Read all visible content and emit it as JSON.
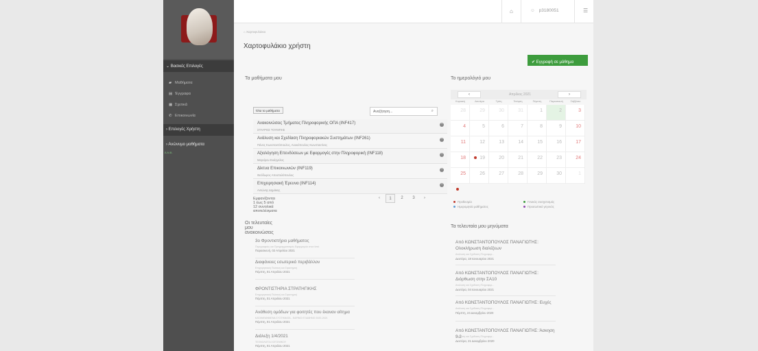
{
  "colors": {
    "accent": "#3d9c3d",
    "sidebar": "#4f4f4f",
    "event_red": "#c0392b"
  },
  "topbar": {
    "home_icon": "home-icon",
    "user_icon": "user-icon",
    "menu_icon": "menu-icon",
    "username": "p3180051"
  },
  "sidebar": {
    "section_main": "Βασικές Επιλογές",
    "items": [
      {
        "label": "Μαθήματα",
        "icon": "mortarboard-icon"
      },
      {
        "label": "Έγγραφα",
        "icon": "document-icon"
      },
      {
        "label": "Σχετικά",
        "icon": "calendar-icon"
      },
      {
        "label": "Επικοινωνία",
        "icon": "phone-icon"
      }
    ],
    "section_user": "Επιλογές Χρήστη",
    "section_anon": "Ανώνυμο μαθήματα",
    "small_text": "Ά.Ν.Β."
  },
  "breadcrumb": "Χαρτοφυλάκιο",
  "page_title": "Χαρτοφυλάκιο χρήστη",
  "enroll_button": "Εγγραφή σε μάθημα",
  "courses": {
    "title": "Τα μαθήματα μου",
    "all_button": "Όλα τα μαθήματα",
    "search_placeholder": "Αναζήτηση...",
    "items": [
      {
        "name": "Ανακοινώσεις Τμήματος Πληροφορικής ΟΠΑ (INF417)",
        "prof": "ΣΤΑΥΡΟΣ ΤΟΥΜΠΗΣ"
      },
      {
        "name": "Ανάλυση και Σχεδίαση Πληροφοριακών Συστημάτων (INF261)",
        "prof": "Πάνος Κωνσταντόπουλος, Λουκόπουλος Κωνσταντίνος"
      },
      {
        "name": "Αξιολόγηση Επενδύσεων με Εφαρμογές στην Πληροφορική (INF118)",
        "prof": "Μαγείρου Ευάγγελος"
      },
      {
        "name": "Δίκτυα Επικοινωνιών (INF119)",
        "prof": "Θεόδωρος Αποστολόπουλος"
      },
      {
        "name": "Επιχειρησιακή Έρευνα (INF114)",
        "prof": "Αντώνης Δημάκης"
      }
    ],
    "pagination_info": "Εμφανίζονται 1 έως 5 από 12 συνολικά αποτελέσματα",
    "pages": [
      "‹",
      "1",
      "2",
      "3",
      "›"
    ]
  },
  "announcements": {
    "title": "Οι τελευταίες μου ανακοινώσεις",
    "items": [
      {
        "title": "3ο Φροντιστήριο μαθήματος",
        "sub": "Περιγραφικές και Προγραμματισμός Εφαρμογών στον Ιστό",
        "date": "Παρασκευή, 02 Απριλίου 2021"
      },
      {
        "title": "Διαφάνειες εσωτερικό περιβάλλον",
        "sub": "Επιχειρησιακή Πολιτική και Στρατηγική",
        "date": "Πέμπτη, 01 Απριλίου 2021"
      },
      {
        "title": "ΦΡΟΝΤΙΣΤΗΡΙΑ ΣΤΡΑΤΗΓΙΚΗΣ",
        "sub": "Επιχειρησιακή Πολιτική και Στρατηγική",
        "date": "Πέμπτη, 01 Απριλίου 2021"
      },
      {
        "title": "Ανάθεση ομάδων για φοιτητές που έκαναν αίτημα",
        "sub": "ΚΑΤΑΝΕΜΗΜΕΝΑ ΣΥΣΤΗΜΑΤΑ - ΕΑΡΙΝΟ ΕΞΑΜΗΝΟ 2020-2021",
        "date": "Πέμπτη, 01 Απριλίου 2021"
      },
      {
        "title": "Διάλεξη 1/4/2021",
        "sub": "ΤΕΧΝΟΛΟΓΙΑ ΛΟΓΙΣΜΙΚΟΥ",
        "date": "Πέμπτη, 01 Απριλίου 2021"
      }
    ]
  },
  "calendar": {
    "title": "Το ημερολόγιό μου",
    "month": "Απρίλιος 2021",
    "prev": "‹",
    "next": "›",
    "weekdays": [
      "Κυριακή",
      "Δευτέρα",
      "Τρίτη",
      "Τετάρτη",
      "Πέμπτη",
      "Παρασκευή",
      "Σάββατο"
    ],
    "weeks": [
      [
        "28",
        "29",
        "30",
        "31",
        "1",
        "2",
        "3"
      ],
      [
        "4",
        "5",
        "6",
        "7",
        "8",
        "9",
        "10"
      ],
      [
        "11",
        "12",
        "13",
        "14",
        "15",
        "16",
        "17"
      ],
      [
        "18",
        "19",
        "20",
        "21",
        "22",
        "23",
        "24"
      ],
      [
        "25",
        "26",
        "27",
        "28",
        "29",
        "30",
        "1"
      ]
    ],
    "legend": [
      {
        "label": "Προθεσμία",
        "color": "#c0392b"
      },
      {
        "label": "Γενικός συσχετισμός",
        "color": "#3d9c3d"
      },
      {
        "label": "Ημερομηνία μαθήματος",
        "color": "#5b9bd5"
      },
      {
        "label": "Προσωπικό γεγονός",
        "color": "#8e44ad"
      }
    ]
  },
  "messages": {
    "title": "Τα τελευταία μου μηνύματα",
    "items": [
      {
        "title": "Από ΚΩΝΣΤΑΝΤΟΠΟΥΛΟΣ ΠΑΝΑΓΙΩΤΗΣ: Ολοκλήρωση διαλέξεων",
        "sub": "Ανάλυση και Σχεδίαση Πληροφορ...",
        "date": "Δευτέρα, 18 Ιανουαρίου 2021"
      },
      {
        "title": "Από ΚΩΝΣΤΑΝΤΟΠΟΥΛΟΣ ΠΑΝΑΓΙΩΤΗΣ: Διόρθωση στην ΣΑ10",
        "sub": "Ανάλυση και Σχεδίαση Πληροφορ...",
        "date": "Δευτέρα, 04 Ιανουαρίου 2021"
      },
      {
        "title": "Από ΚΩΝΣΤΑΝΤΟΠΟΥΛΟΣ ΠΑΝΑΓΙΩΤΗΣ: Ευχές",
        "sub": "Ανάλυση και Σχεδίαση Πληροφορ...",
        "date": "Πέμπτη, 24 Δεκεμβρίου 2020"
      },
      {
        "title": "Από ΚΩΝΣΤΑΝΤΟΠΟΥΛΟΣ ΠΑΝΑΓΙΩΤΗΣ: Άσκηση 9.2",
        "sub": "Ανάλυση και Σχεδίαση Πληροφορ...",
        "date": "Δευτέρα, 21 Δεκεμβρίου 2020"
      }
    ]
  }
}
